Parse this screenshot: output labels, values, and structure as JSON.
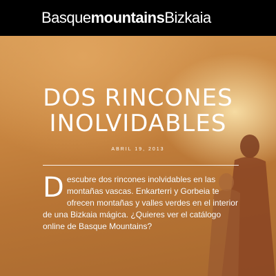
{
  "header": {
    "logo_part1": "Basque",
    "logo_part2": "mountains",
    "logo_part3": "Bizkaia",
    "background": "#000000"
  },
  "article": {
    "title_line1": "DOS RINCONES",
    "title_line2": "INOLVIDABLES",
    "date": "ABRIL 19, 2013",
    "dropcap": "D",
    "body": "escubre dos rincones inolvidables en las montañas vascas. Enkarterri y Gorbeia te ofrecen montañas y valles verdes en el interior de una Bizkaia mágica. ¿Quieres ver el catálogo online de Basque Mountains?"
  },
  "colors": {
    "hero_warm": "#c98a42",
    "text": "#ffffff"
  }
}
